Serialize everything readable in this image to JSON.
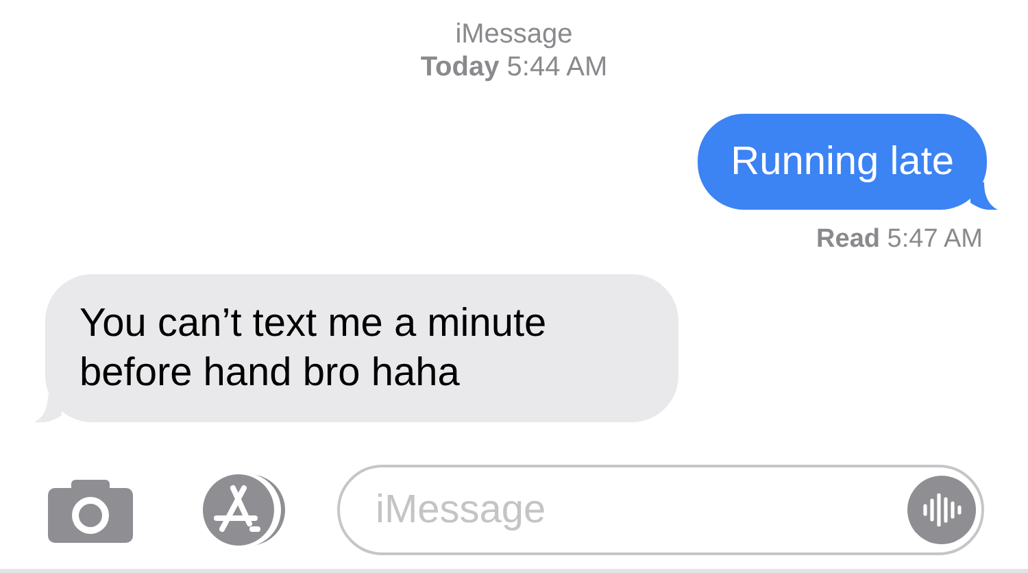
{
  "header": {
    "service": "iMessage",
    "timestamp": "**Today** 5:44 AM"
  },
  "messages": [
    {
      "kind": "sent",
      "text": "Running late",
      "receipt": "**Read** 5:47 AM"
    },
    {
      "kind": "received",
      "text": "You can’t text me a minute before hand bro haha"
    }
  ],
  "composer": {
    "placeholder": "iMessage"
  }
}
